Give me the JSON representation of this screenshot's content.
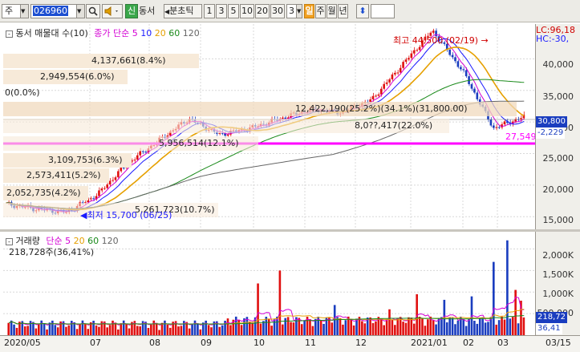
{
  "toolbar": {
    "market": "주",
    "code": "026960",
    "buttons": [
      "신",
      "동서",
      "분초틱",
      "1",
      "3",
      "5",
      "10",
      "20",
      "30"
    ],
    "interval": "3",
    "periods": [
      "일",
      "주",
      "월",
      "년"
    ]
  },
  "price_pane": {
    "legend_title": "동서 매물대 수(10)",
    "legend_ma_prefix": "종가 단순",
    "legend_ma": [
      {
        "label": "5",
        "color": "#d400d4"
      },
      {
        "label": "10",
        "color": "#1a1aff"
      },
      {
        "label": "20",
        "color": "#e6a000"
      },
      {
        "label": "60",
        "color": "#1a8a1a"
      },
      {
        "label": "120",
        "color": "#666666"
      }
    ],
    "volume_profile": [
      {
        "label": "4,137,661(8.4%)",
        "value": 8.4
      },
      {
        "label": "2,949,554(6.0%)",
        "value": 6.0
      },
      {
        "label": "0(0.0%)",
        "value": 0.0
      },
      {
        "label": "12,422,190(25.2%)(34.1%)(31,800.00)",
        "value": 25.2
      },
      {
        "label": "8,0??,417(22.0%)",
        "value": 22.0
      },
      {
        "label": "5,956,514(12.1%)",
        "value": 12.1
      },
      {
        "label": "3,109,753(6.3%)",
        "value": 6.3
      },
      {
        "label": "2,573,411(5.2%)",
        "value": 5.2
      },
      {
        "label": "2,052,735(4.2%)",
        "value": 4.2
      },
      {
        "label": "5,261,723(10.7%)",
        "value": 10.7
      }
    ],
    "high_label": "최고 44,500 (02/19)",
    "low_label": "최저 15,700 (06/25)",
    "last_close_label": "27,549",
    "lc_label": "LC:96,18",
    "hc_label": "HC:-30,",
    "price_ticks": [
      "40,000",
      "35,000",
      "30,000",
      "25,000",
      "20,000",
      "15,000"
    ],
    "current_price": "30,800",
    "current_change": "-2,229"
  },
  "volume_pane": {
    "legend_title": "거래량",
    "legend_ma_prefix": "단순",
    "legend_ma": [
      {
        "label": "5",
        "color": "#d400d4"
      },
      {
        "label": "20",
        "color": "#e6a000"
      },
      {
        "label": "60",
        "color": "#1a8a1a"
      },
      {
        "label": "120",
        "color": "#666666"
      }
    ],
    "info": "218,728주(36,41%)",
    "ticks": [
      "2,000K",
      "1,500K",
      "1,000K",
      "500,000"
    ],
    "current_volume": "218,72",
    "current_pct": "36,41"
  },
  "date_axis": {
    "labels": [
      "2020/05",
      "07",
      "08",
      "09",
      "10",
      "11",
      "12",
      "2021/01",
      "02",
      "03",
      "03/15"
    ]
  },
  "chart_data": {
    "type": "candlestick",
    "title": "동서 매물대 수(10)",
    "x_range": [
      "2020/05",
      "2021/03/15"
    ],
    "y_range": [
      13000,
      45500
    ],
    "approx_close": [
      [
        "2020/05",
        17000
      ],
      [
        "2020/06",
        16200
      ],
      [
        "2020/06/25",
        15700
      ],
      [
        "2020/07",
        18500
      ],
      [
        "2020/08",
        23500
      ],
      [
        "2020/09",
        27000
      ],
      [
        "2020/09/20",
        30500
      ],
      [
        "2020/10",
        28000
      ],
      [
        "2020/11",
        29000
      ],
      [
        "2020/12",
        30500
      ],
      [
        "2020/12/20",
        32000
      ],
      [
        "2021/01",
        31500
      ],
      [
        "2021/01/20",
        33500
      ],
      [
        "2021/02/05",
        39000
      ],
      [
        "2021/02/19",
        44500
      ],
      [
        "2021/03/01",
        38000
      ],
      [
        "2021/03/10",
        29000
      ],
      [
        "2021/03/15",
        30800
      ]
    ],
    "support_line": 27549
  }
}
